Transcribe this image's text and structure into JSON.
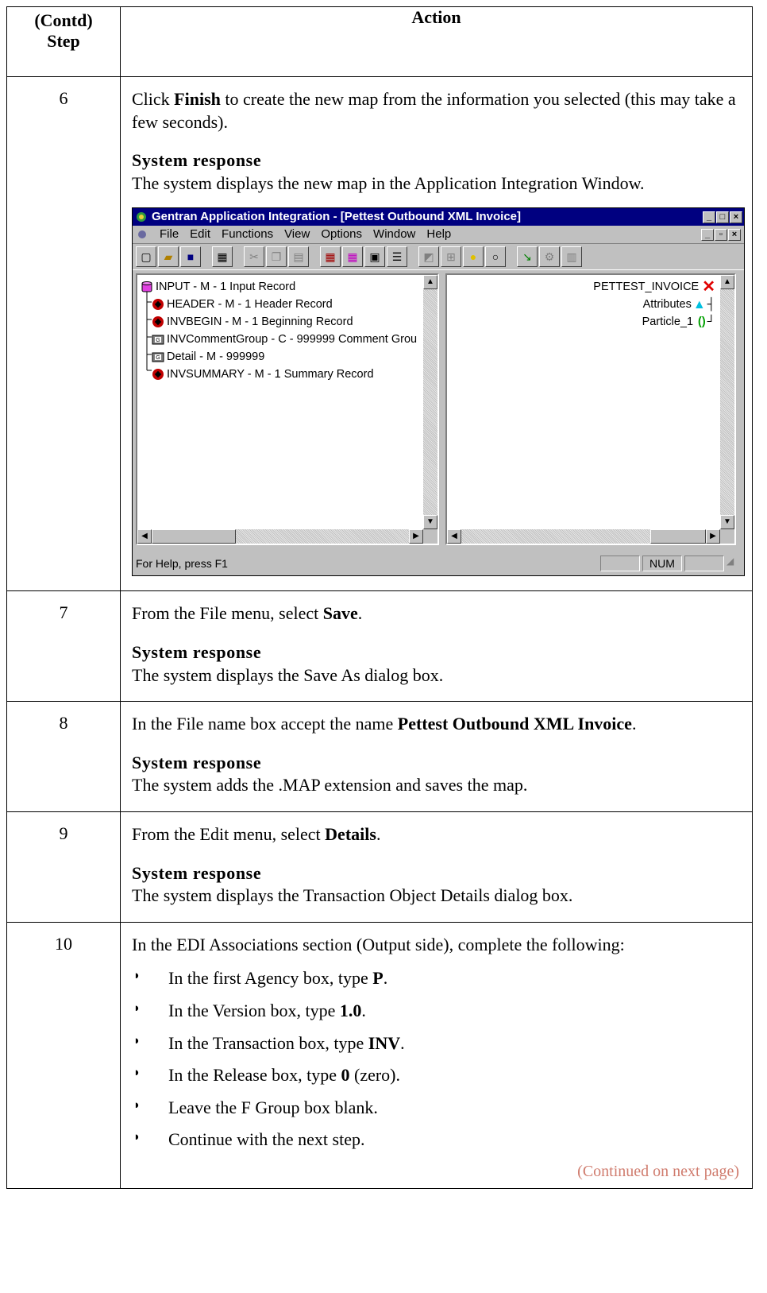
{
  "header": {
    "step_label_line1": "(Contd)",
    "step_label_line2": "Step",
    "action_label": "Action"
  },
  "steps": [
    {
      "num": "6",
      "pre": "Click ",
      "bold": "Finish",
      "post": " to create the new map from the information you selected (this may take a few seconds).",
      "response_title": "System response",
      "response_text": "The system displays the new map in the Application Integration Window."
    },
    {
      "num": "7",
      "pre": "From the File menu, select ",
      "bold": "Save",
      "post": ".",
      "response_title": "System response",
      "response_text": "The system displays the Save As dialog box."
    },
    {
      "num": "8",
      "pre": "In the File name box accept the name ",
      "bold": "Pettest Outbound XML Invoice",
      "post": ".",
      "response_title": "System response",
      "response_text": "The system adds the .MAP extension and saves the map."
    },
    {
      "num": "9",
      "pre": "From the Edit menu, select ",
      "bold": "Details",
      "post": ".",
      "response_title": "System response",
      "response_text": "The system displays the Transaction Object Details dialog box."
    },
    {
      "num": "10",
      "intro": "In the EDI Associations section (Output side), complete the following:",
      "bullets": [
        {
          "pre": "In the first Agency box, type ",
          "bold": "P",
          "post": "."
        },
        {
          "pre": "In the Version box, type ",
          "bold": "1.0",
          "post": "."
        },
        {
          "pre": "In the Transaction box, type ",
          "bold": "INV",
          "post": "."
        },
        {
          "pre": "In the Release box, type ",
          "bold": "0",
          "post": " (zero)."
        },
        {
          "pre": "Leave the F Group box blank.",
          "bold": "",
          "post": ""
        },
        {
          "pre": "Continue with the next step.",
          "bold": "",
          "post": ""
        }
      ],
      "continued": "(Continued on next page)"
    }
  ],
  "screenshot": {
    "title": "Gentran Application Integration - [Pettest Outbound XML Invoice]",
    "menus": [
      "File",
      "Edit",
      "Functions",
      "View",
      "Options",
      "Window",
      "Help"
    ],
    "left_tree": [
      {
        "label": "INPUT - M -  1 Input Record",
        "icon": "cylinder-icon"
      },
      {
        "label": "HEADER - M -  1 Header Record",
        "icon": "record-icon"
      },
      {
        "label": "INVBEGIN - M -  1 Beginning Record",
        "icon": "record-icon"
      },
      {
        "label": "INVCommentGroup - C -  999999 Comment Grou",
        "icon": "group-icon"
      },
      {
        "label": "Detail - M -  999999",
        "icon": "group-icon"
      },
      {
        "label": "INVSUMMARY - M -  1 Summary Record",
        "icon": "record-icon"
      }
    ],
    "right_tree": [
      {
        "label": "PETTEST_INVOICE",
        "icon": "red-x-icon"
      },
      {
        "label": "Attributes",
        "icon": "cyan-triangle-icon"
      },
      {
        "label": "Particle_1",
        "icon": "green-paren-icon"
      }
    ],
    "status_text": "For Help, press F1",
    "status_num": "NUM"
  }
}
